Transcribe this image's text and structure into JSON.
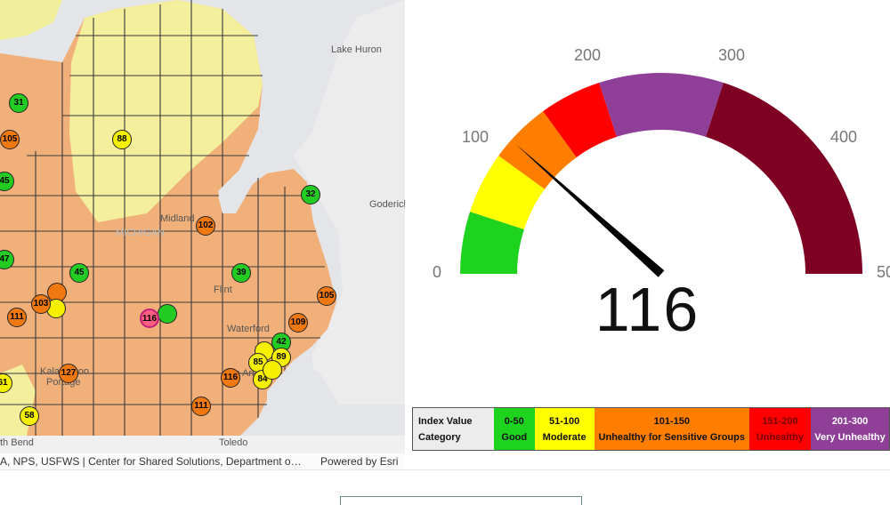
{
  "map": {
    "place_labels": [
      "Lake Huron",
      "Goderich",
      "Midland",
      "Flint",
      "Waterford",
      "Ann Arbor",
      "Kalamazoo",
      "Portage",
      "Toledo",
      "th Bend",
      "MICHIGAN"
    ],
    "attribution": "A, NPS, USFWS | Center for Shared Solutions, Department o…",
    "powered_by": "Powered by Esri",
    "stations": [
      {
        "label": "31",
        "color": "#22cc22"
      },
      {
        "label": "105",
        "color": "#f07810"
      },
      {
        "label": "88",
        "color": "#f5f000"
      },
      {
        "label": "45",
        "color": "#22cc22"
      },
      {
        "label": "32",
        "color": "#22cc22"
      },
      {
        "label": "102",
        "color": "#f07810"
      },
      {
        "label": "47",
        "color": "#22cc22"
      },
      {
        "label": "45",
        "color": "#22cc22"
      },
      {
        "label": "39",
        "color": "#22cc22"
      },
      {
        "label": "",
        "color": "#f07810"
      },
      {
        "label": "103",
        "color": "#f07810"
      },
      {
        "label": "",
        "color": "#f5f000"
      },
      {
        "label": "105",
        "color": "#f07810"
      },
      {
        "label": "111",
        "color": "#f07810"
      },
      {
        "label": "116",
        "color": "#ff5e7e"
      },
      {
        "label": "",
        "color": "#22cc22"
      },
      {
        "label": "109",
        "color": "#f07810"
      },
      {
        "label": "42",
        "color": "#22cc22"
      },
      {
        "label": "",
        "color": "#f5f000"
      },
      {
        "label": "89",
        "color": "#f5f000"
      },
      {
        "label": "85",
        "color": "#f5f000"
      },
      {
        "label": "127",
        "color": "#f07810"
      },
      {
        "label": "116",
        "color": "#f07810"
      },
      {
        "label": "84",
        "color": "#f5f000"
      },
      {
        "label": "",
        "color": "#f5f000"
      },
      {
        "label": "61",
        "color": "#f5f000"
      },
      {
        "label": "58",
        "color": "#f5f000"
      },
      {
        "label": "111",
        "color": "#f07810"
      }
    ]
  },
  "gauge": {
    "value": 116,
    "display_value": "116",
    "min": 0,
    "max": 500,
    "tick_labels": [
      "0",
      "100",
      "200",
      "300",
      "400",
      "50"
    ],
    "bands": [
      {
        "from": 0,
        "to": 50,
        "color": "#1ed31e"
      },
      {
        "from": 50,
        "to": 100,
        "color": "#ffff00"
      },
      {
        "from": 100,
        "to": 150,
        "color": "#ff7e00"
      },
      {
        "from": 150,
        "to": 200,
        "color": "#ff0000"
      },
      {
        "from": 200,
        "to": 300,
        "color": "#8f3f97"
      },
      {
        "from": 300,
        "to": 500,
        "color": "#7e0023"
      }
    ]
  },
  "legend": {
    "header_top": "Index Value",
    "header_bottom": "Category",
    "cells": [
      {
        "range": "0-50",
        "category": "Good",
        "color": "#1ed31e",
        "text_color": "#111111"
      },
      {
        "range": "51-100",
        "category": "Moderate",
        "color": "#ffff00",
        "text_color": "#111111"
      },
      {
        "range": "101-150",
        "category": "Unhealthy for Sensitive Groups",
        "color": "#ff7e00",
        "text_color": "#111111"
      },
      {
        "range": "151-200",
        "category": "Unhealthy",
        "color": "#ff0000",
        "text_color": "#7a0000"
      },
      {
        "range": "201-300",
        "category": "Very Unhealthy",
        "color": "#8f3f97",
        "text_color": "#ffffff"
      }
    ]
  }
}
